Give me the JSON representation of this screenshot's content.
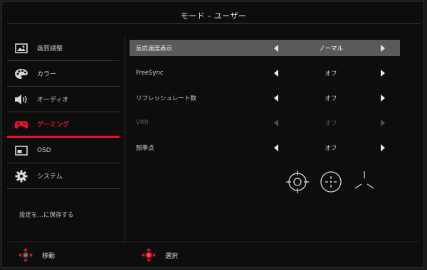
{
  "title": "モード - ユーザー",
  "sidebar": {
    "items": [
      {
        "label": "画質調整",
        "icon": "image-icon",
        "active": false
      },
      {
        "label": "カラー",
        "icon": "palette-icon",
        "active": false
      },
      {
        "label": "オーディオ",
        "icon": "speaker-icon",
        "active": false
      },
      {
        "label": "ゲーミング",
        "icon": "gamepad-icon",
        "active": true
      },
      {
        "label": "OSD",
        "icon": "osd-window-icon",
        "active": false
      },
      {
        "label": "システム",
        "icon": "gear-icon",
        "active": false
      }
    ],
    "save_label": "設定を…に保存する"
  },
  "settings": [
    {
      "name": "反応速度表示",
      "value": "ノーマル",
      "selected": true,
      "disabled": false
    },
    {
      "name": "FreeSync",
      "value": "オフ",
      "selected": false,
      "disabled": false
    },
    {
      "name": "リフレッシュレート数",
      "value": "オフ",
      "selected": false,
      "disabled": false
    },
    {
      "name": "VRB",
      "value": "オフ",
      "selected": false,
      "disabled": true
    },
    {
      "name": "照準点",
      "value": "オフ",
      "selected": false,
      "disabled": false
    }
  ],
  "crosshair_options": [
    "crosshair-circle-icon",
    "crosshair-dots-icon",
    "crosshair-tri-icon"
  ],
  "footer": {
    "move_label": "移動",
    "select_label": "選択"
  },
  "colors": {
    "accent": "#e0162b",
    "selected_row": "#5a5a5c"
  }
}
